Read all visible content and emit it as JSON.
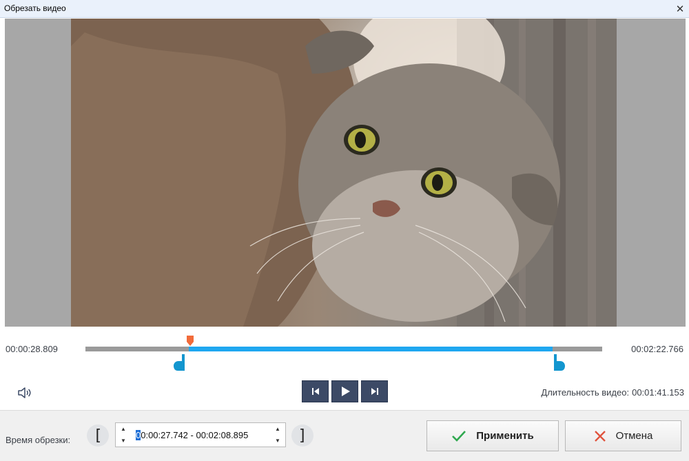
{
  "window": {
    "title": "Обрезать видео",
    "close_glyph": "✕"
  },
  "video": {
    "description_icon": "video-frame",
    "background_color": "#a7a7a7"
  },
  "timeline": {
    "start_time": "00:00:28.809",
    "end_time": "00:02:22.766",
    "accent_color": "#1fa7f0",
    "playhead_color": "#f26b3a"
  },
  "playback": {
    "volume_icon": "speaker-icon",
    "buttons": [
      "skip-back-icon",
      "play-icon",
      "skip-forward-icon"
    ],
    "duration_label": "Длительность видео:",
    "duration_value": "00:01:41.153"
  },
  "trim": {
    "label": "Время обрезки:",
    "start_bracket": "[",
    "end_bracket": "]",
    "cursor_char": "0",
    "range_rest": "0:00:27.742 - 00:02:08.895"
  },
  "actions": {
    "apply_label": "Применить",
    "cancel_label": "Отмена"
  }
}
